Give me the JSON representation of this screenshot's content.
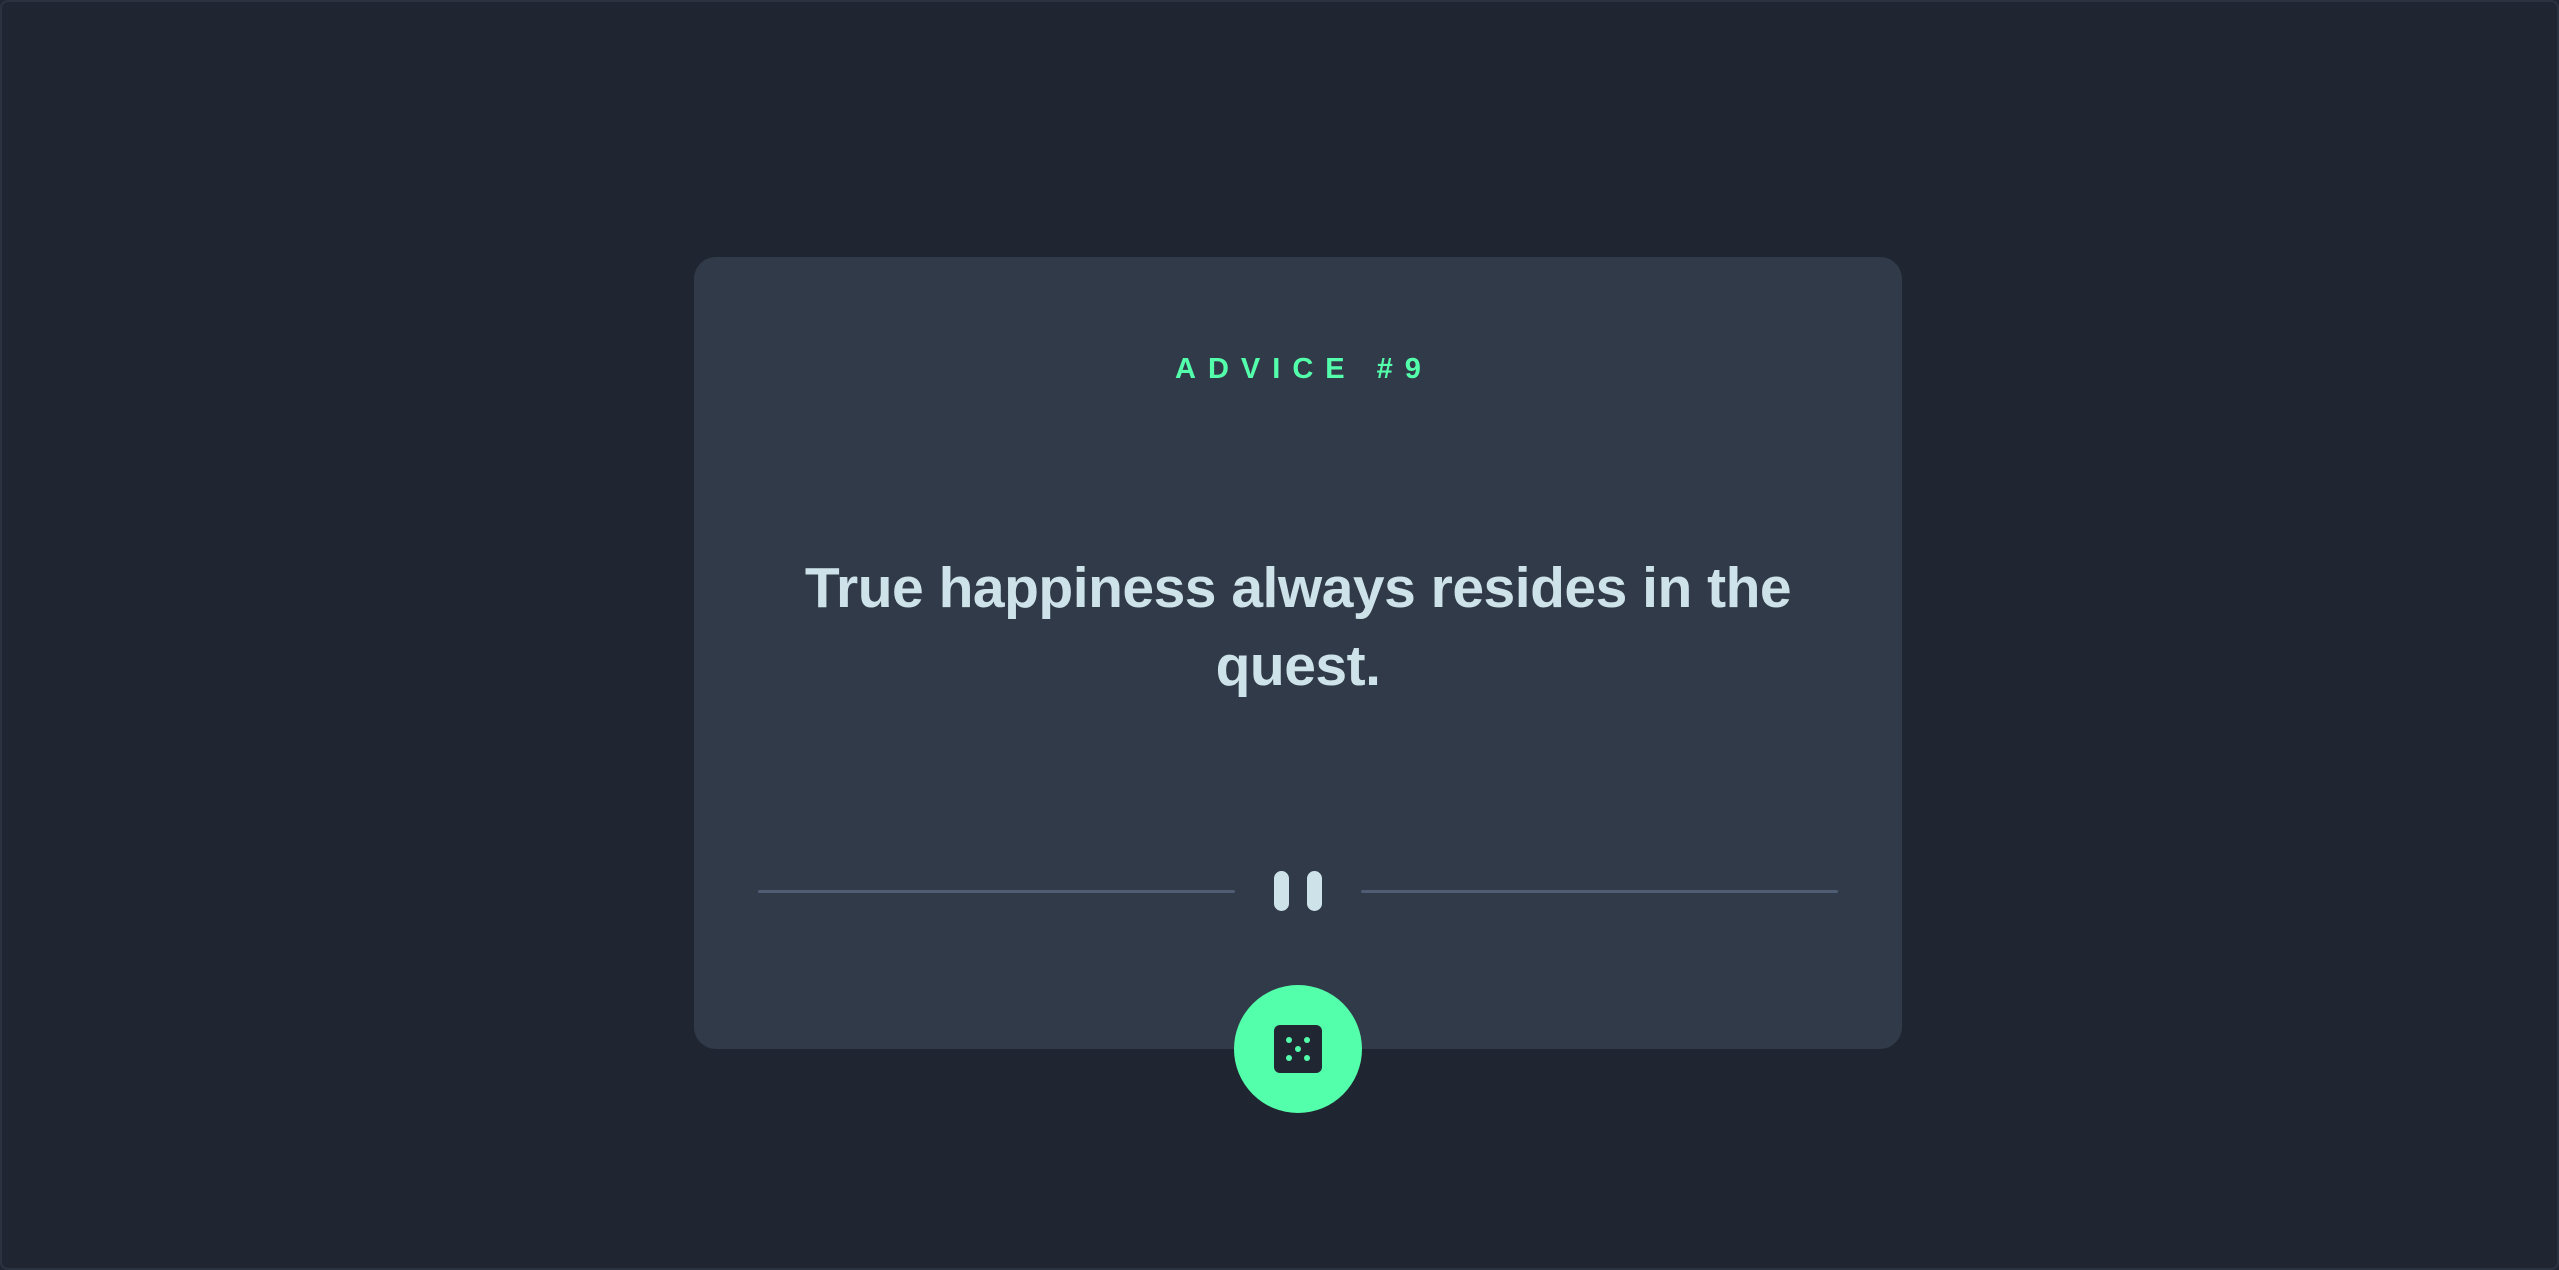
{
  "advice": {
    "label": "ADVICE #9",
    "text": "True happiness always resides in the quest."
  },
  "divider": {
    "icon": "pause-icon"
  },
  "button": {
    "icon": "dice-icon",
    "aria_label": "Generate new advice"
  },
  "colors": {
    "background": "#202733",
    "card": "#313a48",
    "accent": "#53ffaa",
    "text": "#cee3e9",
    "divider": "#4e5d73"
  }
}
